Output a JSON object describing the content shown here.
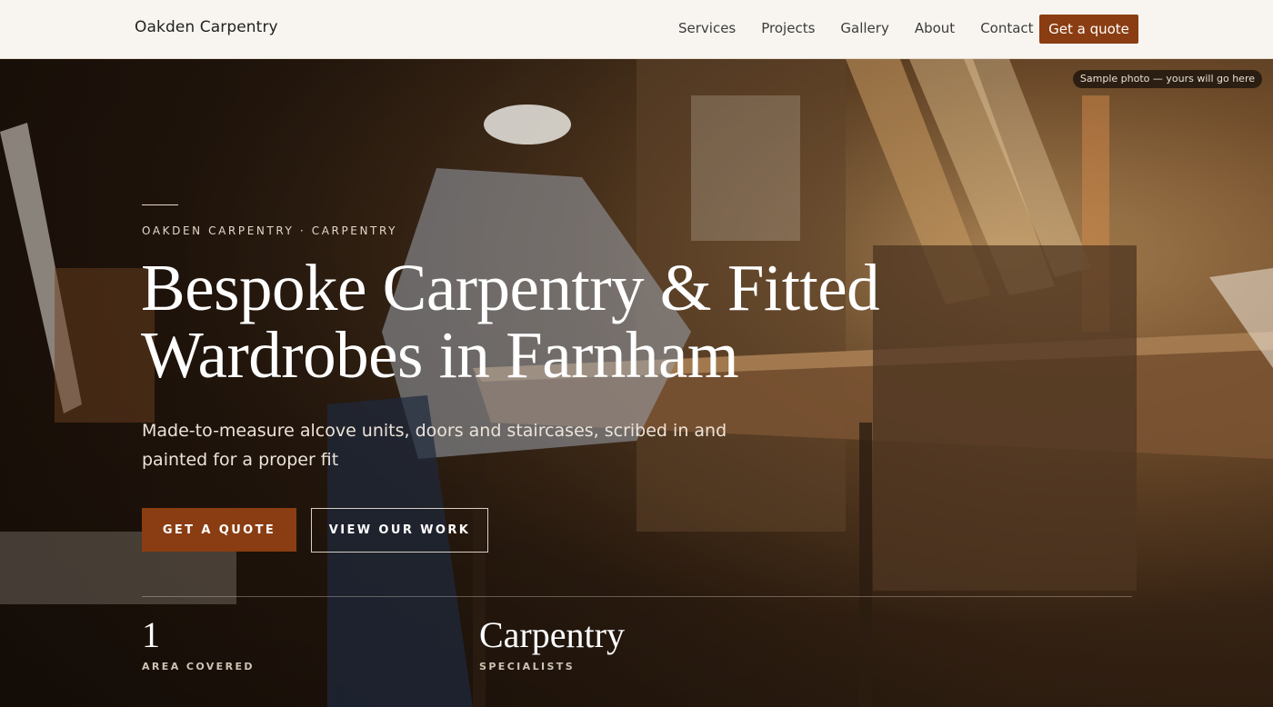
{
  "brand": "Oakden Carpentry",
  "nav": {
    "links": [
      "Services",
      "Projects",
      "Gallery",
      "About",
      "Contact"
    ],
    "cta": "Get a quote"
  },
  "hero": {
    "photo_tag": "Sample photo — yours will go here",
    "eyebrow": "OAKDEN CARPENTRY · CARPENTRY",
    "headline": "Bespoke Carpentry & Fitted Wardrobes in Farnham",
    "subhead": "Made-to-measure alcove units, doors and staircases, scribed in and painted for a proper fit",
    "primary_button": "GET A QUOTE",
    "secondary_button": "VIEW OUR WORK",
    "stats": [
      {
        "value": "1",
        "label": "AREA COVERED"
      },
      {
        "value": "Carpentry",
        "label": "SPECIALISTS"
      }
    ]
  },
  "colors": {
    "accent": "#8a3d12",
    "nav_background": "#f8f5f0"
  }
}
